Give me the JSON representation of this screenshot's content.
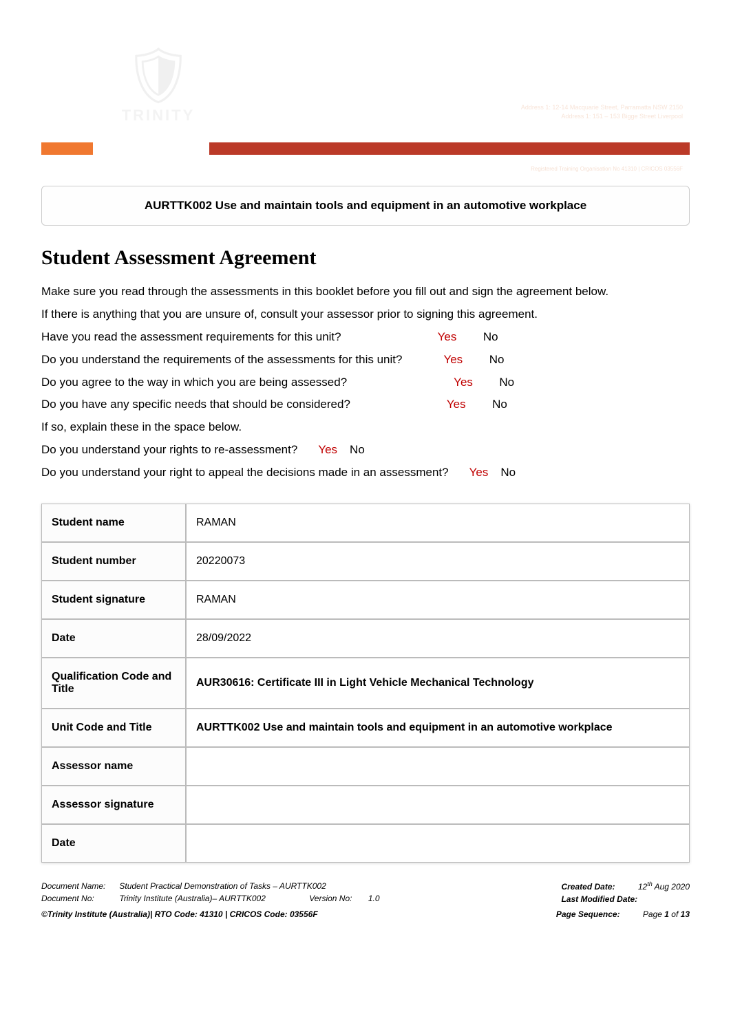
{
  "header": {
    "logo_text": "TRINITY",
    "address_line1": "Address 1: 12-14 Macquarie Street, Parramatta NSW 2150",
    "address_line2": "Address 1: 151 – 153 Bigge Street Liverpool",
    "sub_address": "Registered Training Organisation No 41310 | CRICOS 03556F"
  },
  "doc_title": "AURTTK002 Use and maintain tools and equipment in an automotive workplace",
  "section_heading": "Student Assessment Agreement",
  "intro": {
    "p1": "Make sure you read through the assessments in this booklet before you fill out and sign the agreement below.",
    "p2": "If there is anything that you are unsure of, consult your assessor prior to signing this agreement."
  },
  "questions": {
    "q1": "Have you read the assessment requirements for this unit?",
    "q2": "Do you understand the requirements of the assessments for this unit?",
    "q3": "Do you agree to the way in which you are being assessed?",
    "q4": "Do you have any specific needs that should be considered?",
    "q5": "If so, explain these in the space below.",
    "q6": "Do you understand your rights to re-assessment?",
    "q7": "Do you understand your right to appeal the decisions made in an assessment?"
  },
  "answers": {
    "yes": "Yes",
    "no": "No",
    "no_box": " No",
    "yes_box": " Yes"
  },
  "table": {
    "student_name_label": "Student name",
    "student_name_value": "RAMAN",
    "student_number_label": "Student number",
    "student_number_value": "20220073",
    "student_signature_label": "Student signature",
    "student_signature_value": "RAMAN",
    "date_label": "Date",
    "date_value": "28/09/2022",
    "qualification_label": "Qualification Code and Title",
    "qualification_value": "AUR30616: Certificate III in Light Vehicle Mechanical Technology",
    "unit_label": "Unit Code and Title",
    "unit_value": "AURTTK002 Use and maintain tools and equipment in an automotive workplace",
    "assessor_name_label": "Assessor name",
    "assessor_name_value": "",
    "assessor_signature_label": "Assessor signature",
    "assessor_signature_value": "",
    "date2_label": "Date",
    "date2_value": ""
  },
  "footer": {
    "doc_name_label": "Document Name:",
    "doc_name_value": "Student Practical Demonstration of Tasks – AURTTK002",
    "doc_no_label": "Document No:",
    "doc_no_value": "Trinity Institute (Australia)– AURTTK002",
    "version_label": "Version No:",
    "version_value": "1.0",
    "created_label": "Created Date:",
    "created_value_pre": "12",
    "created_value_sup": "th",
    "created_value_post": " Aug 2020",
    "modified_label": "Last Modified Date:",
    "copyright": "©Trinity Institute (Australia)| RTO Code: 41310 | CRICOS Code: 03556F",
    "page_seq_label": "Page Sequence:",
    "page_value_pre": "Page ",
    "page_num": "1",
    "page_value_mid": " of ",
    "page_total": "13"
  }
}
